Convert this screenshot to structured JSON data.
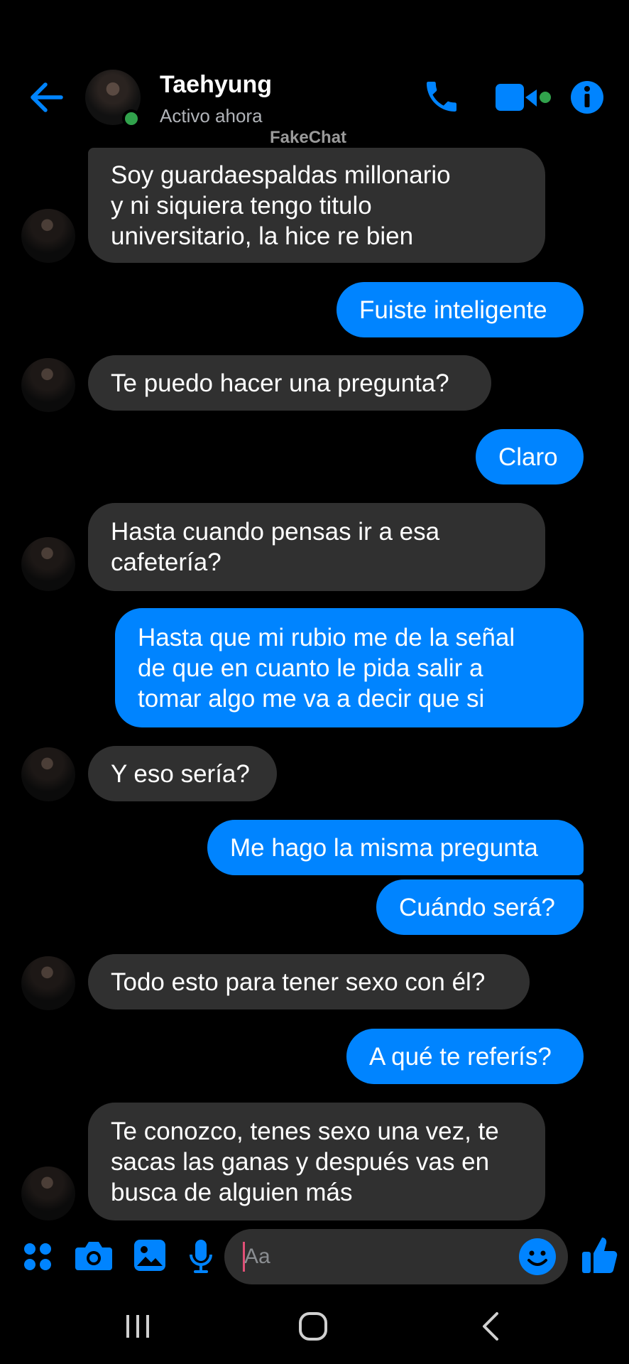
{
  "header": {
    "contact_name": "Taehyung",
    "status": "Activo ahora",
    "watermark": "FakeChat"
  },
  "colors": {
    "accent": "#0084ff",
    "incoming_bubble": "#303030",
    "online": "#31a24c"
  },
  "messages": [
    {
      "from": "them",
      "text": "Soy guardaespaldas millonario\ny ni siquiera tengo titulo\nuniversitario, la hice re bien"
    },
    {
      "from": "me",
      "text": "Fuiste inteligente"
    },
    {
      "from": "them",
      "text": "Te puedo hacer una pregunta?"
    },
    {
      "from": "me",
      "text": "Claro"
    },
    {
      "from": "them",
      "text": "Hasta cuando pensas ir a esa\ncafetería?"
    },
    {
      "from": "me",
      "text": "Hasta que mi rubio me de la señal\nde que en cuanto le pida salir a\ntomar algo me va a decir que si"
    },
    {
      "from": "them",
      "text": "Y eso sería?"
    },
    {
      "from": "me",
      "text": "Me hago la misma pregunta"
    },
    {
      "from": "me",
      "text": "Cuándo será?"
    },
    {
      "from": "them",
      "text": "Todo esto para tener sexo con él?"
    },
    {
      "from": "me",
      "text": "A qué te referís?"
    },
    {
      "from": "them",
      "text": "Te conozco, tenes sexo una vez, te\nsacas las ganas y después vas en\nbusca de alguien más"
    }
  ],
  "composer": {
    "placeholder": "Aa",
    "icons": [
      "apps-icon",
      "camera-icon",
      "gallery-icon",
      "microphone-icon",
      "emoji-icon",
      "like-icon"
    ]
  },
  "navbar": {
    "icons": [
      "recent-apps-icon",
      "home-icon",
      "back-icon"
    ]
  }
}
